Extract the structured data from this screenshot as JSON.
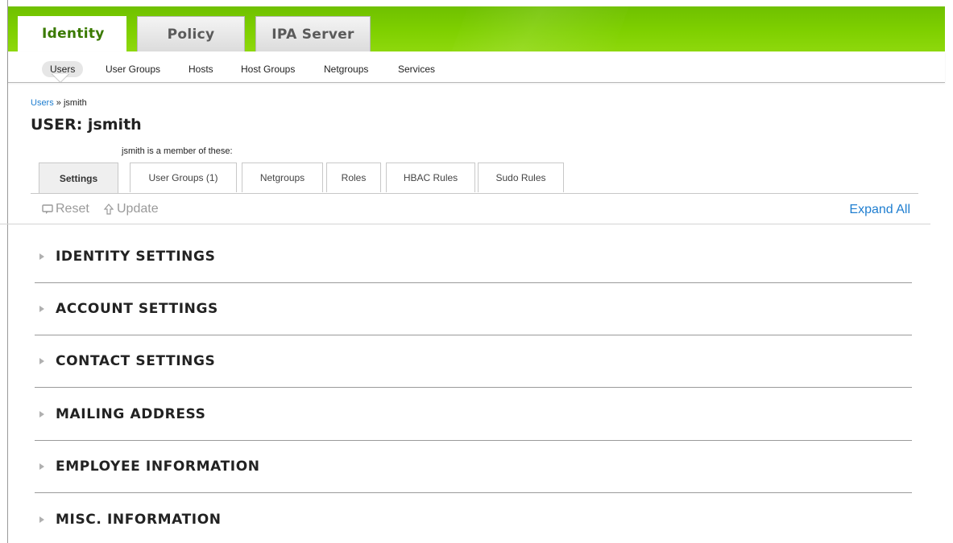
{
  "main_tabs": [
    {
      "label": "Identity",
      "active": true
    },
    {
      "label": "Policy",
      "active": false
    },
    {
      "label": "IPA Server",
      "active": false
    }
  ],
  "sub_nav": [
    {
      "label": "Users",
      "active": true
    },
    {
      "label": "User Groups",
      "active": false
    },
    {
      "label": "Hosts",
      "active": false
    },
    {
      "label": "Host Groups",
      "active": false
    },
    {
      "label": "Netgroups",
      "active": false
    },
    {
      "label": "Services",
      "active": false
    }
  ],
  "breadcrumb": {
    "link": "Users",
    "separator": "»",
    "current": "jsmith"
  },
  "page_title": "USER: jsmith",
  "member_text": "jsmith is a member of these:",
  "facet_tabs": [
    {
      "label": "Settings",
      "active": true
    },
    {
      "label": "User Groups (1)",
      "active": false
    },
    {
      "label": "Netgroups",
      "active": false
    },
    {
      "label": "Roles",
      "active": false
    },
    {
      "label": "HBAC Rules",
      "active": false
    },
    {
      "label": "Sudo Rules",
      "active": false
    }
  ],
  "toolbar": {
    "reset_label": "Reset",
    "update_label": "Update",
    "expand_all_label": "Expand All"
  },
  "sections": [
    "IDENTITY SETTINGS",
    "ACCOUNT SETTINGS",
    "CONTACT SETTINGS",
    "MAILING ADDRESS",
    "EMPLOYEE INFORMATION",
    "MISC. INFORMATION"
  ],
  "colors": {
    "header_green": "#7fd000",
    "active_tab_text": "#3a7a00",
    "link_blue": "#1f7ed0"
  }
}
